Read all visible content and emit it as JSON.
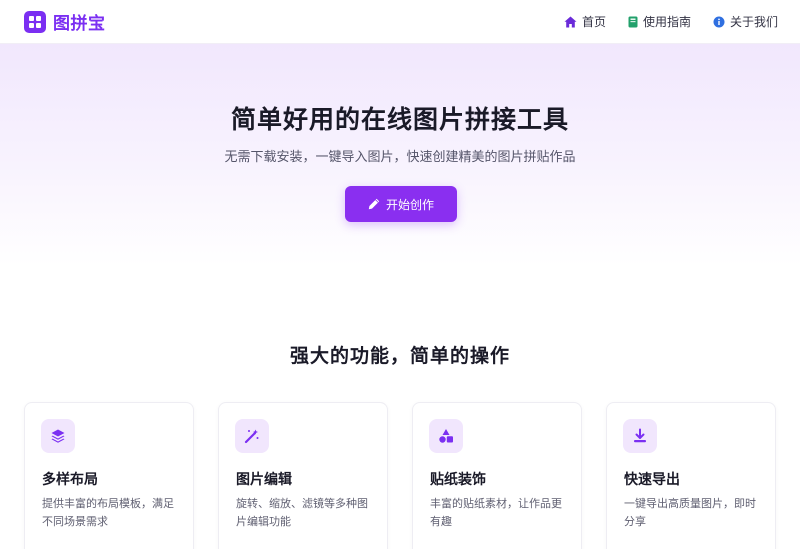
{
  "brand": {
    "name": "图拼宝",
    "logo_icon": "grid-icon",
    "accent": "#7b2ff2"
  },
  "nav": {
    "items": [
      {
        "label": "首页",
        "icon": "home-icon",
        "color": "#6a2bd9"
      },
      {
        "label": "使用指南",
        "icon": "book-icon",
        "color": "#22a06b"
      },
      {
        "label": "关于我们",
        "icon": "info-icon",
        "color": "#2f6fe0"
      }
    ]
  },
  "hero": {
    "title": "简单好用的在线图片拼接工具",
    "subtitle": "无需下载安装，一键导入图片，快速创建精美的图片拼贴作品",
    "cta_label": "开始创作",
    "cta_icon": "pencil-icon",
    "cta_color": "#8a2ff0"
  },
  "features": {
    "title": "强大的功能，简单的操作",
    "items": [
      {
        "title": "多样布局",
        "desc": "提供丰富的布局模板，满足不同场景需求",
        "icon": "layers-icon"
      },
      {
        "title": "图片编辑",
        "desc": "旋转、缩放、滤镜等多种图片编辑功能",
        "icon": "magic-wand-icon"
      },
      {
        "title": "贴纸装饰",
        "desc": "丰富的贴纸素材，让作品更有趣",
        "icon": "shapes-icon"
      },
      {
        "title": "快速导出",
        "desc": "一键导出高质量图片，即时分享",
        "icon": "download-icon"
      }
    ]
  }
}
